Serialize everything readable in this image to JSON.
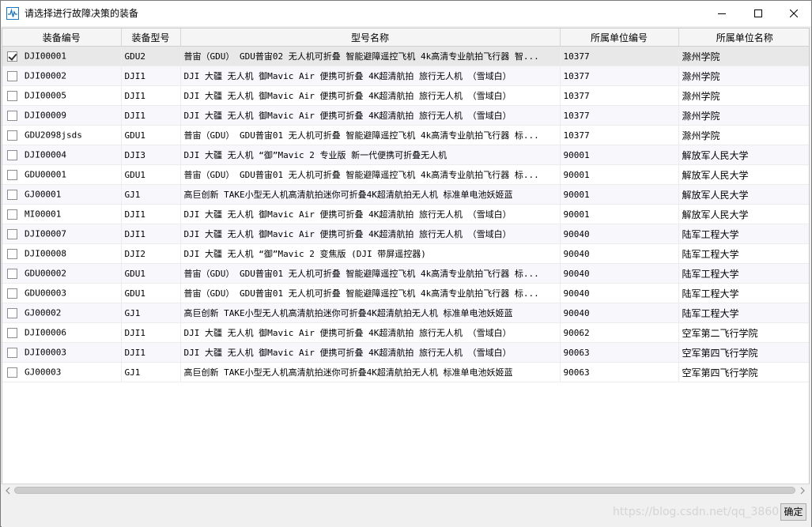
{
  "window": {
    "title": "请选择进行故障决策的装备",
    "watermark": "https://blog.csdn.net/qq_3860"
  },
  "table": {
    "columns": [
      "装备编号",
      "装备型号",
      "型号名称",
      "所属单位编号",
      "所属单位名称"
    ],
    "rows": [
      {
        "checked": true,
        "code": "DJI00001",
        "model": "GDU2",
        "name": "普宙（GDU） GDU普宙02 无人机可折叠 智能避障遥控飞机 4k高清专业航拍飞行器 智...",
        "unit_code": "10377",
        "unit_name": "滁州学院"
      },
      {
        "checked": false,
        "code": "DJI00002",
        "model": "DJI1",
        "name": "DJI 大疆 无人机 御Mavic Air 便携可折叠 4K超清航拍 旅行无人机 （雪域白）",
        "unit_code": "10377",
        "unit_name": "滁州学院"
      },
      {
        "checked": false,
        "code": "DJI00005",
        "model": "DJI1",
        "name": "DJI 大疆 无人机 御Mavic Air 便携可折叠 4K超清航拍 旅行无人机 （雪域白）",
        "unit_code": "10377",
        "unit_name": "滁州学院"
      },
      {
        "checked": false,
        "code": "DJI00009",
        "model": "DJI1",
        "name": "DJI 大疆 无人机 御Mavic Air 便携可折叠 4K超清航拍 旅行无人机 （雪域白）",
        "unit_code": "10377",
        "unit_name": "滁州学院"
      },
      {
        "checked": false,
        "code": "GDU2098jsds",
        "model": "GDU1",
        "name": "普宙（GDU） GDU普宙01 无人机可折叠 智能避障遥控飞机 4k高清专业航拍飞行器 标...",
        "unit_code": "10377",
        "unit_name": "滁州学院"
      },
      {
        "checked": false,
        "code": "DJI00004",
        "model": "DJI3",
        "name": "DJI 大疆 无人机 “御”Mavic 2 专业版 新一代便携可折叠无人机",
        "unit_code": "90001",
        "unit_name": "解放军人民大学"
      },
      {
        "checked": false,
        "code": "GDU00001",
        "model": "GDU1",
        "name": "普宙（GDU） GDU普宙01 无人机可折叠 智能避障遥控飞机 4k高清专业航拍飞行器 标...",
        "unit_code": "90001",
        "unit_name": "解放军人民大学"
      },
      {
        "checked": false,
        "code": "GJ00001",
        "model": "GJ1",
        "name": "高巨创新 TAKE小型无人机高清航拍迷你可折叠4K超清航拍无人机 标准单电池妖姬蓝",
        "unit_code": "90001",
        "unit_name": "解放军人民大学"
      },
      {
        "checked": false,
        "code": "MI00001",
        "model": "DJI1",
        "name": "DJI 大疆 无人机 御Mavic Air 便携可折叠 4K超清航拍 旅行无人机 （雪域白）",
        "unit_code": "90001",
        "unit_name": "解放军人民大学"
      },
      {
        "checked": false,
        "code": "DJI00007",
        "model": "DJI1",
        "name": "DJI 大疆 无人机 御Mavic Air 便携可折叠 4K超清航拍 旅行无人机 （雪域白）",
        "unit_code": "90040",
        "unit_name": "陆军工程大学"
      },
      {
        "checked": false,
        "code": "DJI00008",
        "model": "DJI2",
        "name": "DJI 大疆 无人机 “御”Mavic 2 变焦版 (DJI 带屏遥控器)",
        "unit_code": "90040",
        "unit_name": "陆军工程大学"
      },
      {
        "checked": false,
        "code": "GDU00002",
        "model": "GDU1",
        "name": "普宙（GDU） GDU普宙01 无人机可折叠 智能避障遥控飞机 4k高清专业航拍飞行器 标...",
        "unit_code": "90040",
        "unit_name": "陆军工程大学"
      },
      {
        "checked": false,
        "code": "GDU00003",
        "model": "GDU1",
        "name": "普宙（GDU） GDU普宙01 无人机可折叠 智能避障遥控飞机 4k高清专业航拍飞行器 标...",
        "unit_code": "90040",
        "unit_name": "陆军工程大学"
      },
      {
        "checked": false,
        "code": "GJ00002",
        "model": "GJ1",
        "name": "高巨创新 TAKE小型无人机高清航拍迷你可折叠4K超清航拍无人机 标准单电池妖姬蓝",
        "unit_code": "90040",
        "unit_name": "陆军工程大学"
      },
      {
        "checked": false,
        "code": "DJI00006",
        "model": "DJI1",
        "name": "DJI 大疆 无人机 御Mavic Air 便携可折叠 4K超清航拍 旅行无人机 （雪域白）",
        "unit_code": "90062",
        "unit_name": "空军第二飞行学院"
      },
      {
        "checked": false,
        "code": "DJI00003",
        "model": "DJI1",
        "name": "DJI 大疆 无人机 御Mavic Air 便携可折叠 4K超清航拍 旅行无人机 （雪域白）",
        "unit_code": "90063",
        "unit_name": "空军第四飞行学院"
      },
      {
        "checked": false,
        "code": "GJ00003",
        "model": "GJ1",
        "name": "高巨创新 TAKE小型无人机高清航拍迷你可折叠4K超清航拍无人机 标准单电池妖姬蓝",
        "unit_code": "90063",
        "unit_name": "空军第四飞行学院"
      }
    ]
  },
  "footer": {
    "ok_label": "确定"
  },
  "icons": {
    "app": "waveform-icon",
    "minimize": "minimize-icon",
    "maximize": "maximize-icon",
    "close": "close-icon"
  },
  "colors": {
    "selected_row": "#e8e8e8",
    "alt_row": "#f8f7fc",
    "app_icon": "#1e73be"
  }
}
